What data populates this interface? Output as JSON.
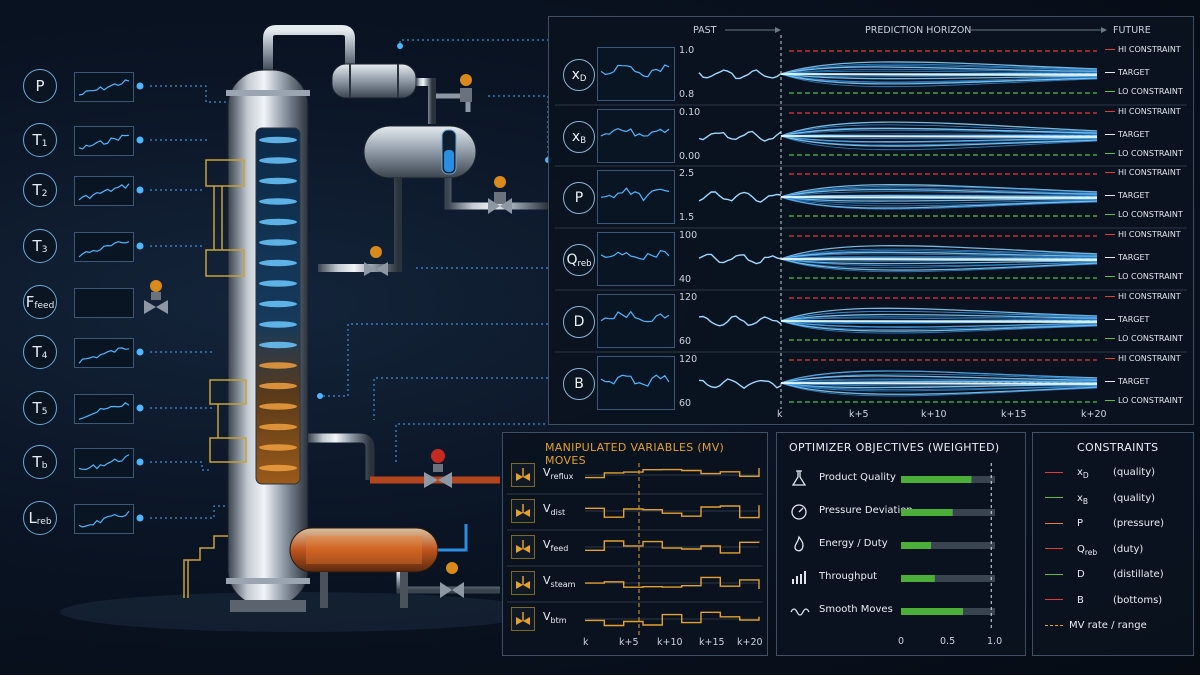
{
  "colors": {
    "accent_blue": "#4fb6ff",
    "hi_constraint": "#e23b3b",
    "target": "#e8e8e8",
    "lo_constraint": "#4fc24a",
    "mv_orange": "#e3a12e",
    "bar_green": "#4caf3a",
    "bar_track": "#3a4350"
  },
  "sensors": [
    {
      "main": "P",
      "sub": ""
    },
    {
      "main": "T",
      "sub": "1"
    },
    {
      "main": "T",
      "sub": "2"
    },
    {
      "main": "T",
      "sub": "3"
    },
    {
      "main": "F",
      "sub": "feed"
    },
    {
      "main": "T",
      "sub": "4"
    },
    {
      "main": "T",
      "sub": "5"
    },
    {
      "main": "T",
      "sub": "b"
    },
    {
      "main": "L",
      "sub": "reb"
    }
  ],
  "prediction": {
    "header_past": "PAST",
    "header_horizon": "PREDICTION HORIZON",
    "header_future": "FUTURE",
    "legend_hi": "HI CONSTRAINT",
    "legend_target": "TARGET",
    "legend_lo": "LO CONSTRAINT",
    "x_ticks": [
      "k",
      "k+5",
      "k+10",
      "k+15",
      "k+20"
    ],
    "rows": [
      {
        "main": "x",
        "sub": "D",
        "y_top": "1.0",
        "y_bot": "0.8"
      },
      {
        "main": "x",
        "sub": "B",
        "y_top": "0.10",
        "y_bot": "0.00"
      },
      {
        "main": "P",
        "sub": "",
        "y_top": "2.5",
        "y_bot": "1.5"
      },
      {
        "main": "Q",
        "sub": "reb",
        "y_top": "100",
        "y_bot": "40"
      },
      {
        "main": "D",
        "sub": "",
        "y_top": "120",
        "y_bot": "60"
      },
      {
        "main": "B",
        "sub": "",
        "y_top": "120",
        "y_bot": "60"
      }
    ]
  },
  "mv_panel": {
    "title": "MANIPULATED VARIABLES (MV) MOVES",
    "x_ticks": [
      "k",
      "k+5",
      "k+10",
      "k+15",
      "k+20"
    ],
    "rows": [
      {
        "main": "V",
        "sub": "reflux",
        "icon": "valve-icon"
      },
      {
        "main": "V",
        "sub": "dist",
        "icon": "valve-icon"
      },
      {
        "main": "V",
        "sub": "feed",
        "icon": "valve-icon"
      },
      {
        "main": "V",
        "sub": "steam",
        "icon": "valve-icon"
      },
      {
        "main": "V",
        "sub": "btm",
        "icon": "valve-icon"
      }
    ]
  },
  "objectives": {
    "title": "OPTIMIZER OBJECTIVES (WEIGHTED)",
    "x_ticks": [
      "0",
      "0.5",
      "1.0"
    ],
    "items": [
      {
        "label": "Product Quality",
        "icon": "flask-icon",
        "value": 0.75
      },
      {
        "label": "Pressure Deviation",
        "icon": "gauge-icon",
        "value": 0.55
      },
      {
        "label": "Energy / Duty",
        "icon": "flame-icon",
        "value": 0.32
      },
      {
        "label": "Throughput",
        "icon": "bar-chart-icon",
        "value": 0.36
      },
      {
        "label": "Smooth Moves",
        "icon": "wave-icon",
        "value": 0.66
      }
    ]
  },
  "constraints": {
    "title": "CONSTRAINTS",
    "items": [
      {
        "main": "x",
        "sub": "D",
        "desc": "(quality)",
        "color": "#e23b3b"
      },
      {
        "main": "x",
        "sub": "B",
        "desc": "(quality)",
        "color": "#4fc24a"
      },
      {
        "main": "P",
        "sub": "",
        "desc": "(pressure)",
        "color": "#e5803a"
      },
      {
        "main": "Q",
        "sub": "reb",
        "desc": "(duty)",
        "color": "#e23b3b"
      },
      {
        "main": "D",
        "sub": "",
        "desc": "(distillate)",
        "color": "#4fc24a"
      },
      {
        "main": "B",
        "sub": "",
        "desc": "(bottoms)",
        "color": "#e23b3b"
      },
      {
        "main": "MV rate / range",
        "sub": "",
        "desc": "",
        "color": "#e3a12e",
        "dashed": true
      }
    ]
  }
}
